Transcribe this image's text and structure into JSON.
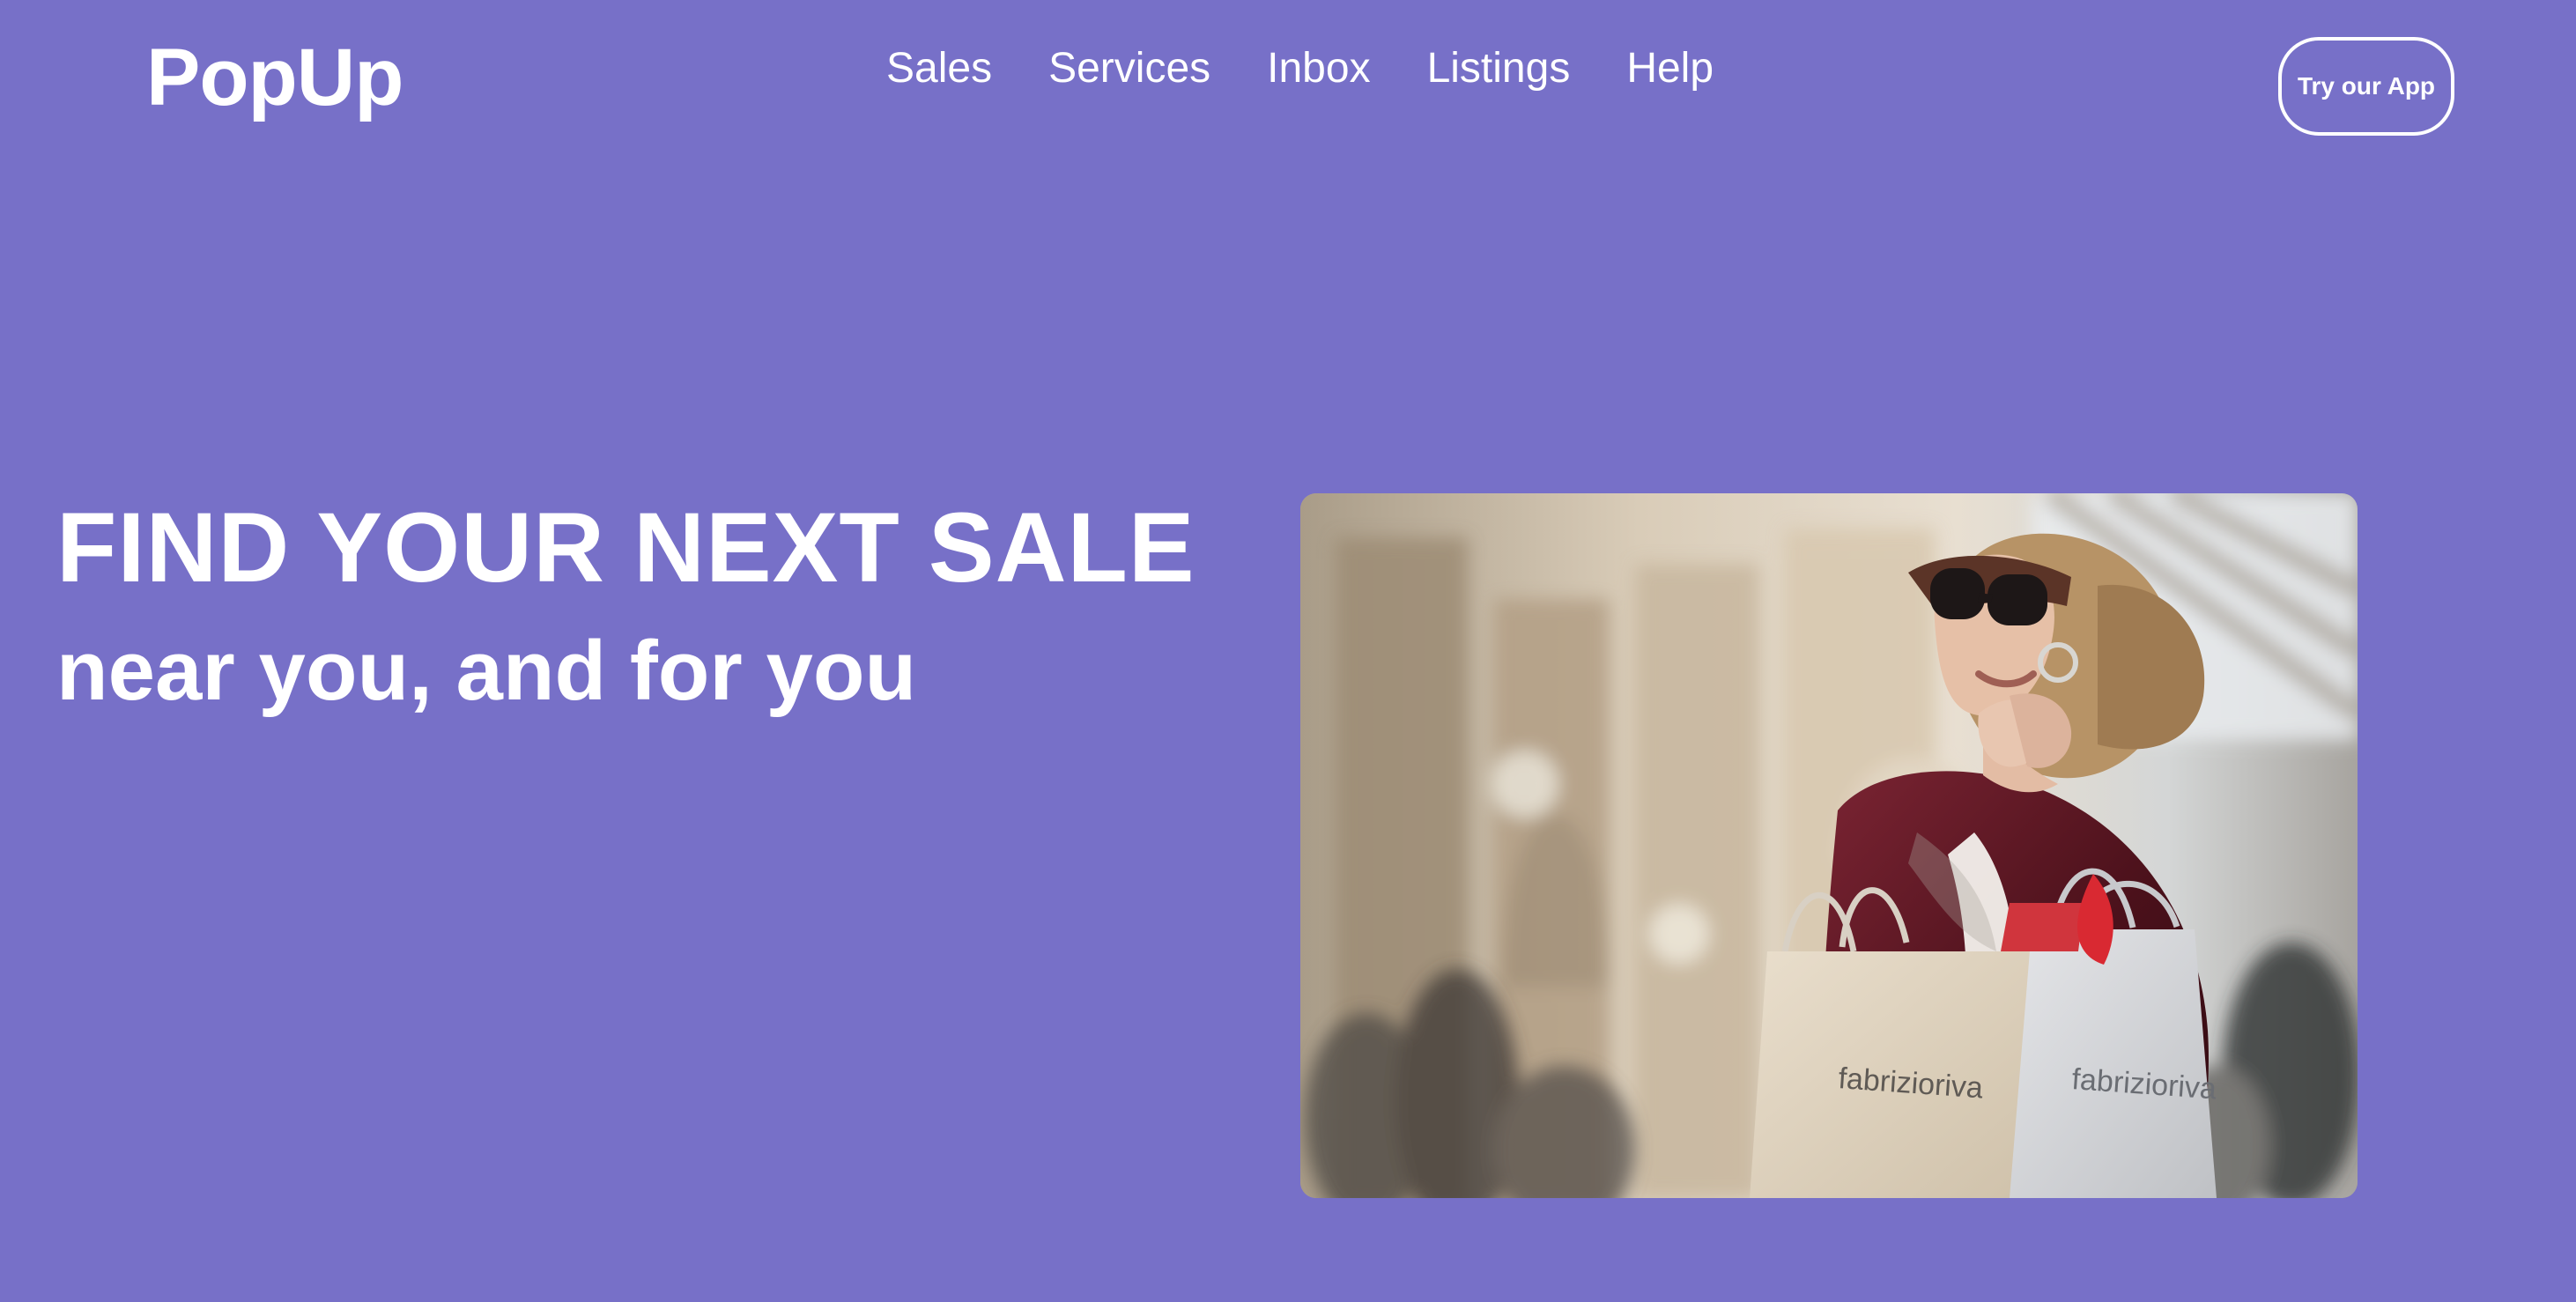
{
  "brand": {
    "name": "PopUp"
  },
  "navigation": {
    "items": [
      {
        "label": "Sales"
      },
      {
        "label": "Services"
      },
      {
        "label": "Inbox"
      },
      {
        "label": "Listings"
      },
      {
        "label": "Help"
      }
    ],
    "cta_label": "Try our App"
  },
  "hero": {
    "title": "FIND YOUR NEXT SALE",
    "subtitle": "near you, and for you",
    "image": {
      "bag_brand": "fabrizioriva"
    }
  },
  "colors": {
    "background": "#7770c8",
    "text": "#ffffff"
  }
}
